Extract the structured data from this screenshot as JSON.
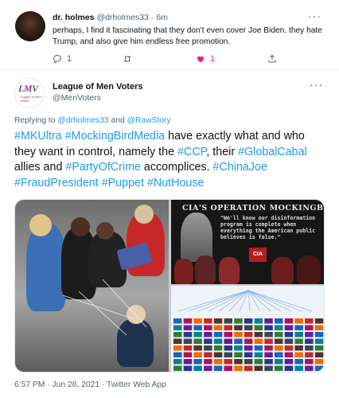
{
  "reply_tweet": {
    "display_name": "dr. holmes",
    "handle": "@drholmes33",
    "time": "6m",
    "separator": "·",
    "text": "perhaps, I find it fascinating that they don't even cover Joe Biden. they hate Trump, and also give him endless free promotion.",
    "more_glyph": "···",
    "actions": {
      "reply_count": "1",
      "retweet_count": "",
      "like_count": "1",
      "share_count": ""
    },
    "colors": {
      "like_active": "#f91880"
    }
  },
  "main_tweet": {
    "avatar": {
      "letters": "LMV",
      "sub": "League of Men Voters"
    },
    "display_name": "League of Men Voters",
    "handle": "@MenVoters",
    "more_glyph": "···",
    "replying_prefix": "Replying to",
    "replying_user1": "@drholmes33",
    "replying_and": "and",
    "replying_user2": "@RawStory",
    "text_parts": {
      "h1": "#MKUltra",
      "h2": "#MockingBirdMedia",
      "t1": "have exactly what and who they want in control, namely the",
      "h3": "#CCP",
      "t2": ", their",
      "h4": "#GlobalCabal",
      "t3": "allies and",
      "h5": "#PartyOfCrime",
      "t4": "accomplices.",
      "h6": "#ChinaJoe",
      "h7": "#FraudPresident",
      "h8": "#Puppet",
      "h9": "#NutHouse"
    },
    "media": {
      "right_top_title": "CIA'S OPERATION MOCKINGBIRD",
      "right_top_quote": "\"We'll know our disinformation program is complete when everything the American public believes is false.\"",
      "cia_logo_text": "CIA"
    },
    "timestamp": "6:57 PM · Jun 28, 2021 · Twitter Web App"
  },
  "colors": {
    "link": "#1d9bf0",
    "secondary_text": "#536471",
    "divider": "#e6ecf0"
  }
}
